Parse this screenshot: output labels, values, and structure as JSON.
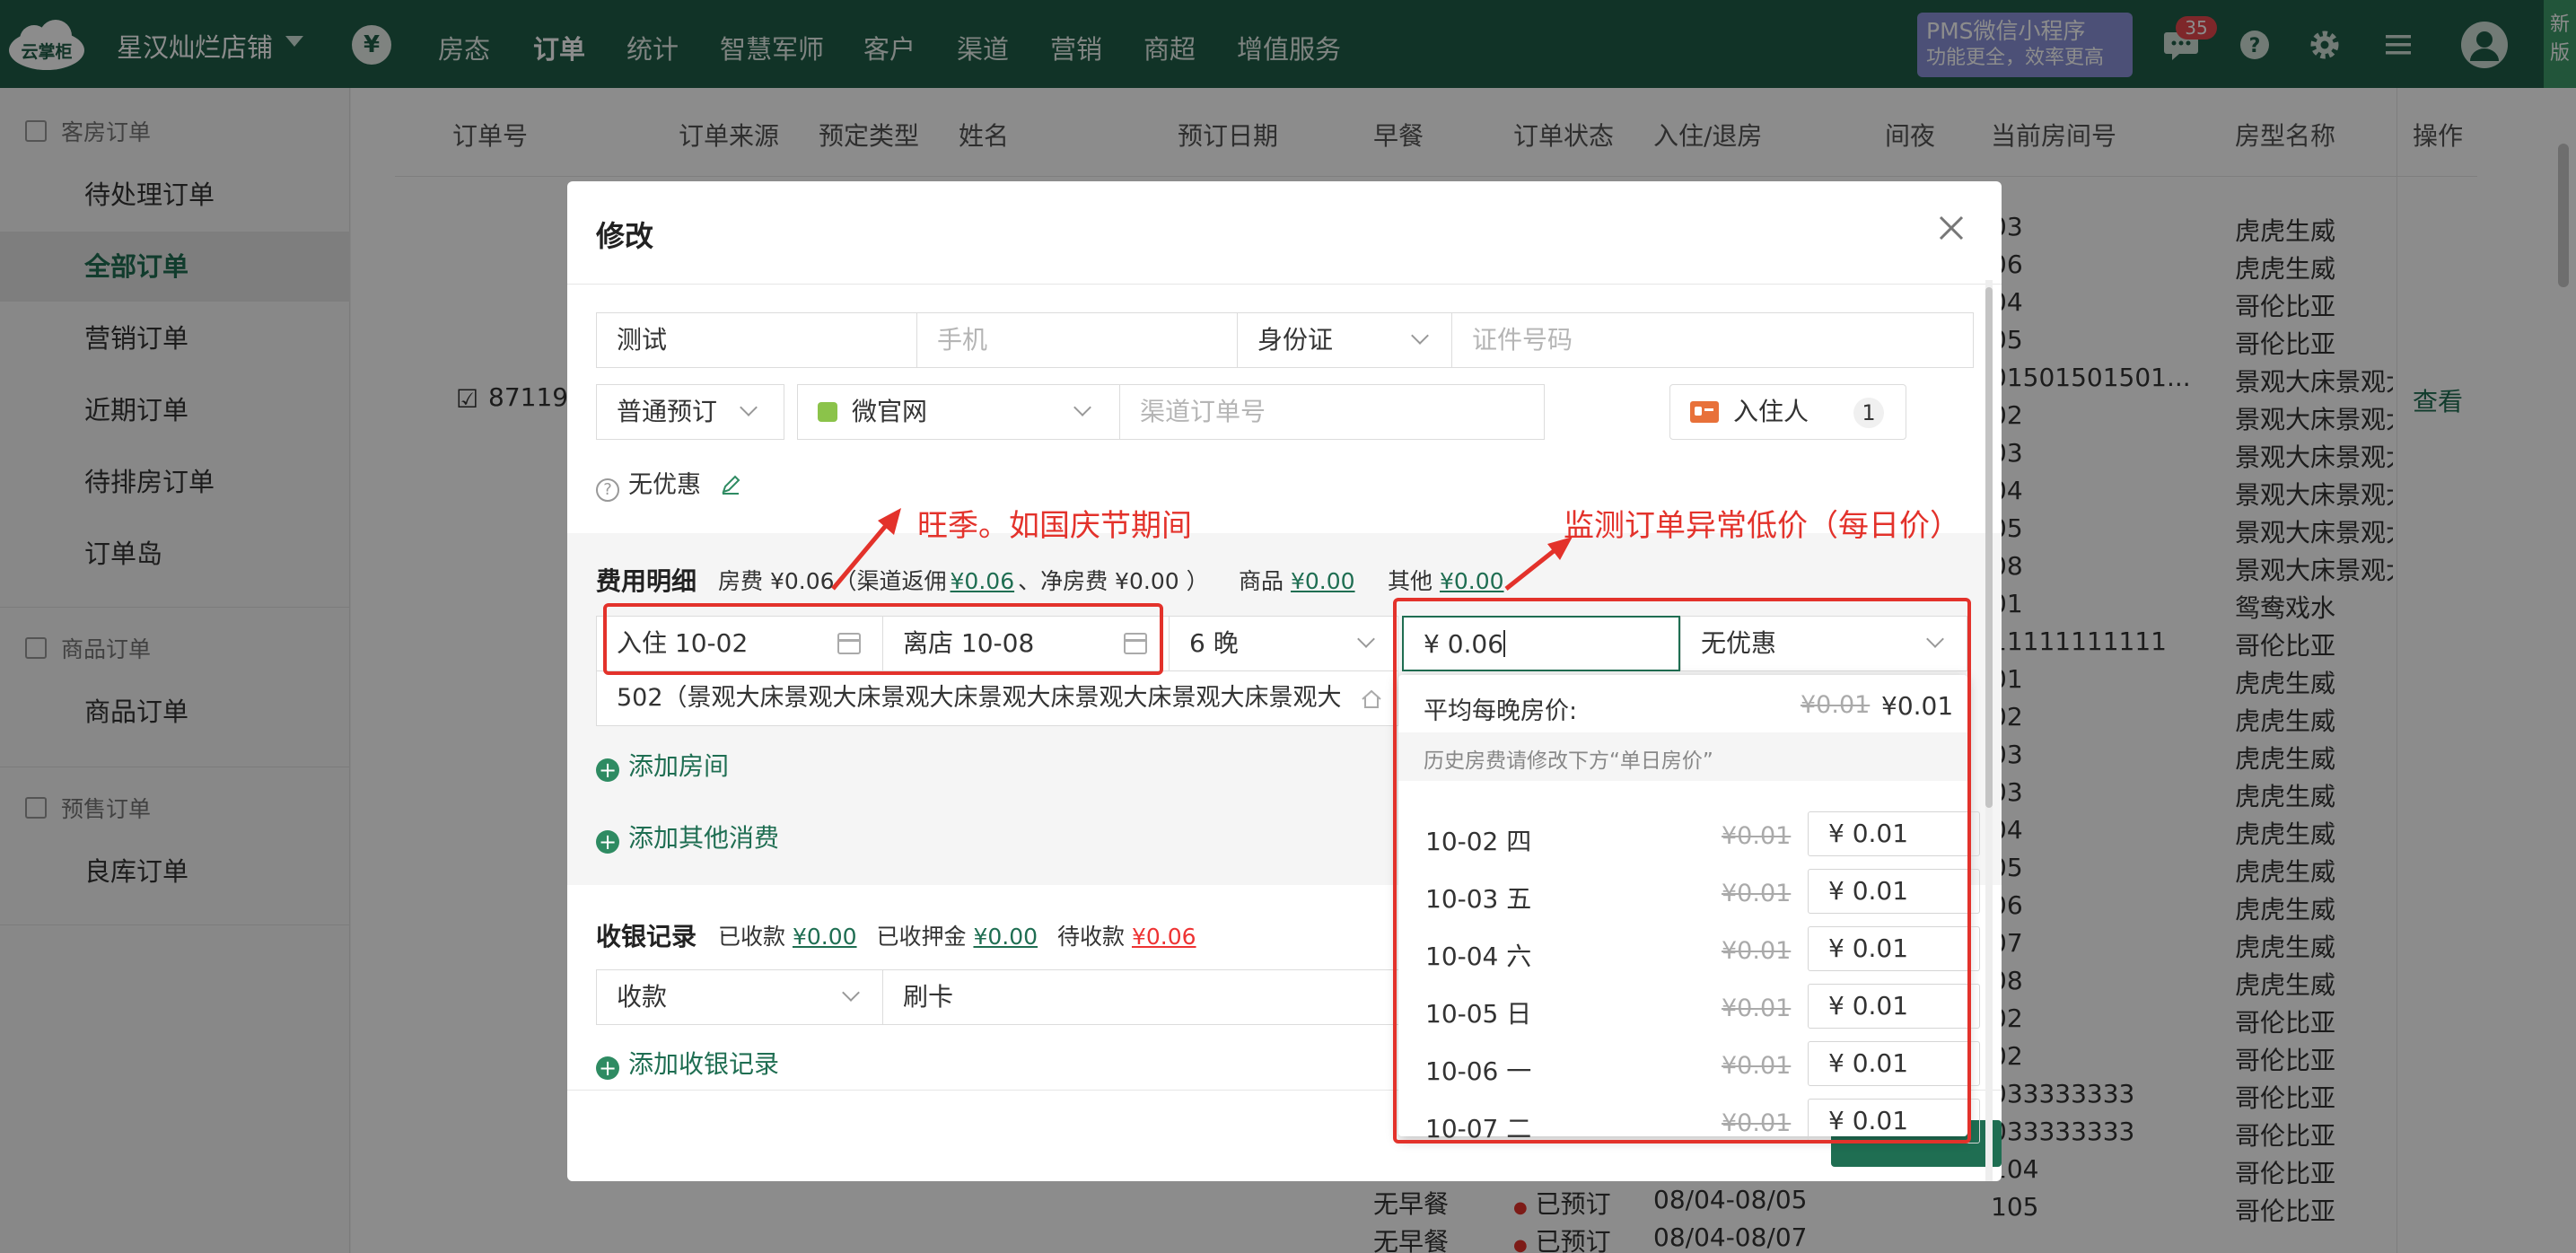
{
  "topbar": {
    "store_name": "星汉灿烂店铺",
    "logo_text": "云掌柜",
    "yen_icon": "¥",
    "nav": [
      "房态",
      "订单",
      "统计",
      "智慧军师",
      "客户",
      "渠道",
      "营销",
      "商超",
      "增值服务"
    ],
    "active_nav": "订单",
    "promo_line1": "PMS微信小程序",
    "promo_line2": "功能更全，效率更高",
    "message_badge": "35",
    "new_version": "新版"
  },
  "sidebar": {
    "group1": "客房订单",
    "group1_items": [
      "待处理订单",
      "全部订单",
      "营销订单",
      "近期订单",
      "待排房订单",
      "订单岛"
    ],
    "active_item": "全部订单",
    "group2": "商品订单",
    "group2_items": [
      "商品订单"
    ],
    "group3": "预售订单",
    "group3_items": [
      "良库订单"
    ]
  },
  "table": {
    "headers": [
      "订单号",
      "订单来源",
      "预定类型",
      "姓名",
      "预订日期",
      "早餐",
      "订单状态",
      "入住/退房",
      "间夜",
      "当前房间号",
      "房型名称",
      "操作"
    ],
    "order_no_partial": "87119",
    "view_link": "查看",
    "room_numbers": [
      "03",
      "06",
      "04",
      "05",
      "01501501501...",
      "02",
      "03",
      "04",
      "05",
      "08",
      "01",
      "11111111111",
      "01",
      "02",
      "03",
      "03",
      "04",
      "05",
      "06",
      "07",
      "08",
      "02",
      "02",
      "033333333",
      "033333333",
      "104",
      "105"
    ],
    "room_types": [
      "虎虎生威",
      "虎虎生威",
      "哥伦比亚",
      "哥伦比亚",
      "景观大床景观大",
      "景观大床景观大",
      "景观大床景观大",
      "景观大床景观大",
      "景观大床景观大",
      "景观大床景观大",
      "鸳鸯戏水",
      "哥伦比亚",
      "虎虎生威",
      "虎虎生威",
      "虎虎生威",
      "虎虎生威",
      "虎虎生威",
      "虎虎生威",
      "虎虎生威",
      "虎虎生威",
      "虎虎生威",
      "哥伦比亚",
      "哥伦比亚",
      "哥伦比亚",
      "哥伦比亚",
      "哥伦比亚",
      "哥伦比亚"
    ],
    "bottom_rows": [
      {
        "breakfast": "无早餐",
        "status": "已预订",
        "dates": "08/04-08/05"
      },
      {
        "breakfast": "无早餐",
        "status": "已预订",
        "dates": "08/04-08/07"
      }
    ]
  },
  "modal": {
    "title": "修改",
    "guest_name": "测试",
    "phone_placeholder": "手机",
    "id_type": "身份证",
    "id_number_placeholder": "证件号码",
    "booking_type": "普通预订",
    "channel": "微官网",
    "channel_order_placeholder": "渠道订单号",
    "guest_button": "入住人",
    "guest_count": "1",
    "discount": "无优惠",
    "fee_section": {
      "title": "费用明细",
      "room_fee": "房费 ¥0.06（渠道返佣",
      "rebate": "¥0.06",
      "net_fee": "、净房费 ¥0.00 ）",
      "goods_label": "商品",
      "goods_value": "¥0.00",
      "other_label": "其他",
      "other_value": "¥0.00"
    },
    "checkin": "入住 10-02",
    "checkout": "离店 10-08",
    "nights": "6 晚",
    "price_input": "¥ 0.06",
    "price_discount": "无优惠",
    "room_desc": "502（景观大床景观大床景观大床景观大床景观大床景观大床景观大",
    "add_room": "添加房间",
    "add_other": "添加其他消费",
    "cashier": {
      "title": "收银记录",
      "received_label": "已收款",
      "received": "¥0.00",
      "deposit_label": "已收押金",
      "deposit": "¥0.00",
      "pending_label": "待收款",
      "pending": "¥0.06",
      "type": "收款",
      "method": "刷卡",
      "add_record": "添加收银记录"
    }
  },
  "popover": {
    "avg_label": "平均每晚房价:",
    "avg_old": "¥0.01",
    "avg_new": "¥0.01",
    "hint": "历史房费请修改下方“单日房价”",
    "days": [
      {
        "date": "10-02 四",
        "old": "¥0.01",
        "price": "¥ 0.01"
      },
      {
        "date": "10-03 五",
        "old": "¥0.01",
        "price": "¥ 0.01"
      },
      {
        "date": "10-04 六",
        "old": "¥0.01",
        "price": "¥ 0.01"
      },
      {
        "date": "10-05 日",
        "old": "¥0.01",
        "price": "¥ 0.01"
      },
      {
        "date": "10-06 一",
        "old": "¥0.01",
        "price": "¥ 0.01"
      },
      {
        "date": "10-07 二",
        "old": "¥0.01",
        "price": "¥ 0.01"
      }
    ]
  },
  "annotations": {
    "left": "旺季。如国庆节期间",
    "right": "监测订单异常低价（每日价）",
    "color": "#e3322b"
  },
  "colors": {
    "brand": "#1f5e48",
    "accent_green": "#1f6e52",
    "warning_red": "#e3322b"
  }
}
